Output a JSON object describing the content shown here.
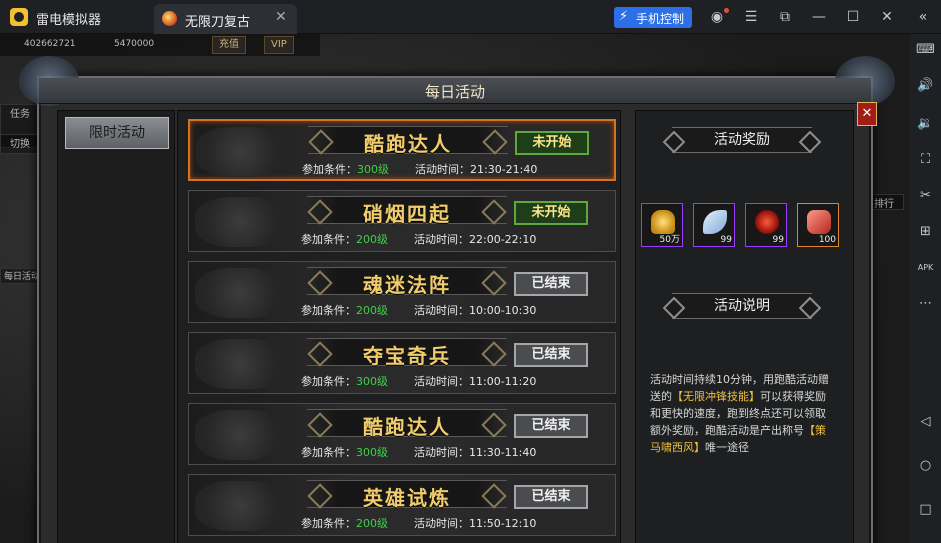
{
  "emulator": {
    "name": "雷电模拟器",
    "tab_title": "无限刀复古",
    "phone_control_label": "手机控制",
    "icons": [
      "user-icon",
      "menu-icon",
      "popout-icon",
      "minimize-icon",
      "maximize-icon",
      "close-icon",
      "collapse-icon"
    ],
    "accent_color": "#2d6fe6"
  },
  "sidebar": {
    "icons": [
      "keyboard-icon",
      "volume-up-icon",
      "volume-down-icon",
      "screenshot-icon",
      "scissors-icon",
      "add-app-icon",
      "apk-icon",
      "more-icon",
      "back-icon",
      "home-icon",
      "recents-icon"
    ],
    "apk_label": "APK"
  },
  "hud": {
    "gold": "402662721",
    "ingot": "5470000",
    "recharge_label": "充值",
    "vip_label": "VIP",
    "task_label": "任务",
    "switch_label": "切换",
    "daily_label": "每日活动",
    "rank_label": "排行"
  },
  "modal": {
    "title": "每日活动",
    "close_label": "✕",
    "side_tab": "限时活动",
    "condition_prefix": "参加条件：",
    "time_prefix": "活动时间：",
    "activities": [
      {
        "name": "酷跑达人",
        "level": "300级",
        "time": "21:30-21:40",
        "status": "未开始",
        "state": "open",
        "selected": true
      },
      {
        "name": "硝烟四起",
        "level": "200级",
        "time": "22:00-22:10",
        "status": "未开始",
        "state": "open",
        "selected": false
      },
      {
        "name": "魂迷法阵",
        "level": "200级",
        "time": "10:00-10:30",
        "status": "已结束",
        "state": "ended",
        "selected": false
      },
      {
        "name": "夺宝奇兵",
        "level": "300级",
        "time": "11:00-11:20",
        "status": "已结束",
        "state": "ended",
        "selected": false
      },
      {
        "name": "酷跑达人",
        "level": "300级",
        "time": "11:30-11:40",
        "status": "已结束",
        "state": "ended",
        "selected": false
      },
      {
        "name": "英雄试炼",
        "level": "200级",
        "time": "11:50-12:10",
        "status": "已结束",
        "state": "ended",
        "selected": false
      }
    ],
    "reward_title": "活动奖励",
    "rewards": [
      {
        "icon": "gold-ingot-icon",
        "qty": "50万",
        "border": "#9a3cff"
      },
      {
        "icon": "feather-icon",
        "qty": "99",
        "border": "#9a3cff"
      },
      {
        "icon": "red-gem-icon",
        "qty": "99",
        "border": "#9a3cff"
      },
      {
        "icon": "scroll-icon",
        "qty": "100",
        "border": "#e0852b"
      }
    ],
    "desc_title": "活动说明",
    "desc_part1": "活动时间持续10分钟，用跑酷活动赠送的",
    "desc_highlight1": "【无限冲锋技能】",
    "desc_part2": "可以获得奖励和更快的速度，跑到终点还可以领取额外奖励，跑酷活动是产出称号",
    "desc_highlight2": "【策马啸西风】",
    "desc_part3": "唯一途径"
  }
}
